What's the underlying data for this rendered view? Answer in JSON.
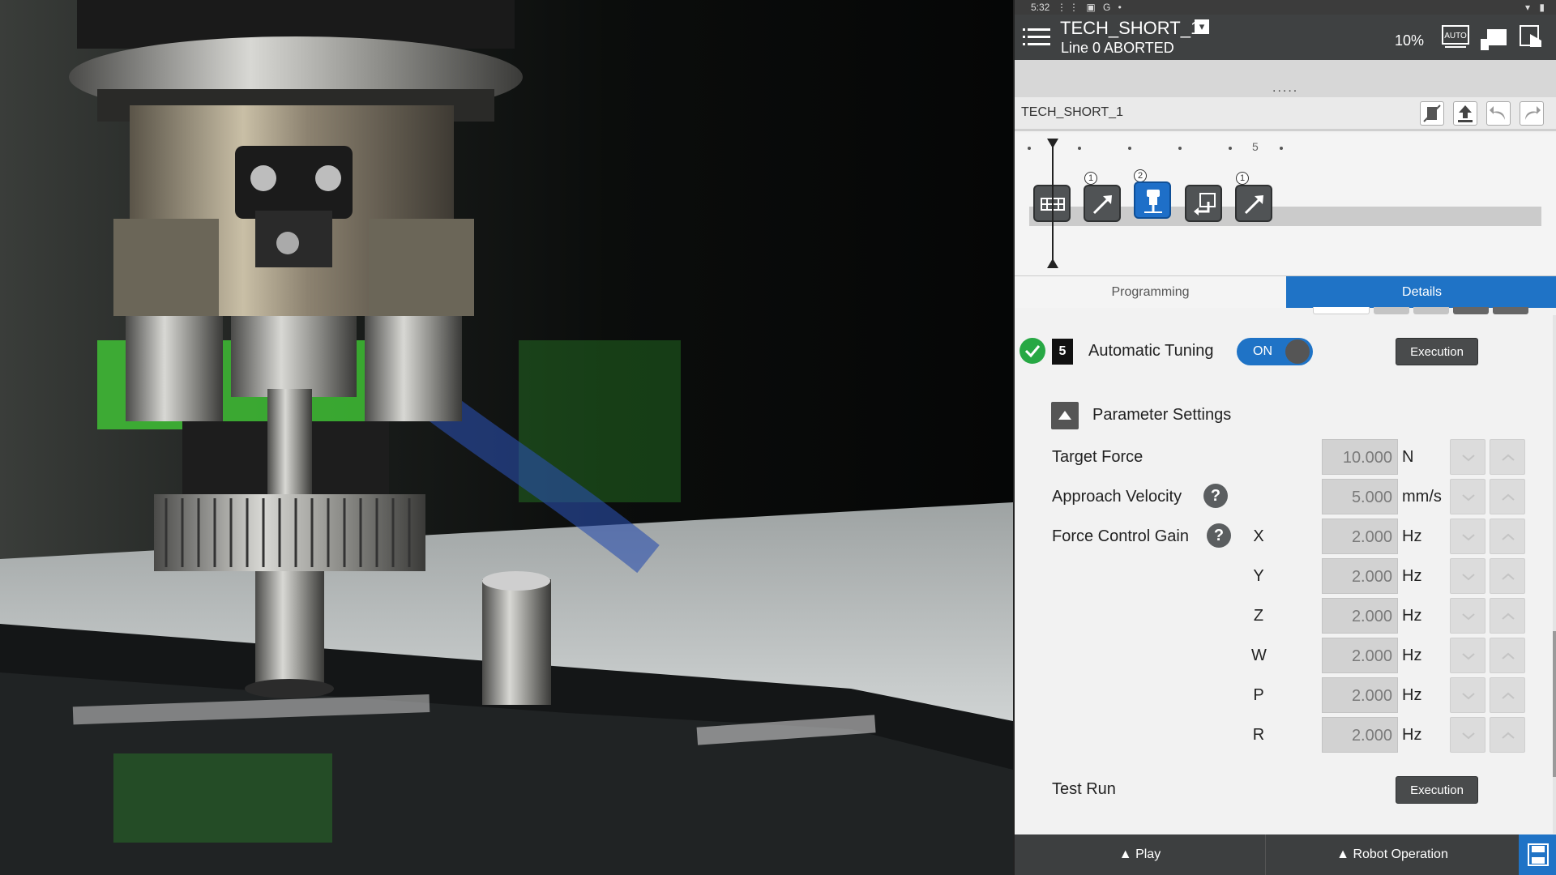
{
  "status_bar": {
    "time": "5:32",
    "sys_icons": "⋮⋮ ▣ G •",
    "right_icons": "▾ ▮"
  },
  "header": {
    "program_title": "TECH_SHORT_1",
    "dropdown_glyph": "▾",
    "line_status": "Line 0 ABORTED",
    "override": "10%",
    "icons": [
      "menu-icon",
      "auto-mode-icon",
      "teach-pendant-icon",
      "touch-hand-icon"
    ]
  },
  "drag_area": {
    "handle": "....."
  },
  "program_bar": {
    "name": "TECH_SHORT_1",
    "tools": [
      "no-touch-icon",
      "upload-icon",
      "undo-icon",
      "redo-icon"
    ]
  },
  "timeline": {
    "marker_label": "5",
    "nodes": [
      {
        "name": "header-block",
        "badge": "",
        "active": false
      },
      {
        "name": "linear-move",
        "badge": "1",
        "active": false
      },
      {
        "name": "force-control",
        "badge": "2",
        "active": true
      },
      {
        "name": "insert-return",
        "badge": "",
        "active": false
      },
      {
        "name": "linear-move",
        "badge": "1",
        "active": false
      }
    ]
  },
  "tabs": {
    "programming": "Programming",
    "details": "Details",
    "active": "details"
  },
  "details": {
    "step_number": "5",
    "automatic_tuning_label": "Automatic Tuning",
    "toggle_state": "ON",
    "execution_label": "Execution",
    "parameter_settings_label": "Parameter Settings",
    "target_force": {
      "label": "Target Force",
      "value": "10.000",
      "unit": "N"
    },
    "approach_velocity": {
      "label": "Approach Velocity",
      "value": "5.000",
      "unit": "mm/s"
    },
    "force_control_gain": {
      "label": "Force Control Gain",
      "axes": [
        {
          "axis": "X",
          "value": "2.000",
          "unit": "Hz"
        },
        {
          "axis": "Y",
          "value": "2.000",
          "unit": "Hz"
        },
        {
          "axis": "Z",
          "value": "2.000",
          "unit": "Hz"
        },
        {
          "axis": "W",
          "value": "2.000",
          "unit": "Hz"
        },
        {
          "axis": "P",
          "value": "2.000",
          "unit": "Hz"
        },
        {
          "axis": "R",
          "value": "2.000",
          "unit": "Hz"
        }
      ]
    },
    "help_glyph": "?",
    "test_run_label": "Test Run",
    "test_run_execution_label": "Execution"
  },
  "footer": {
    "play": "▲ Play",
    "robot_operation": "▲ Robot Operation"
  },
  "colors": {
    "accent_blue": "#1f73c6",
    "header_dark": "#3f4142",
    "ok_green": "#27a844",
    "panel_bg": "#f2f2f2"
  }
}
